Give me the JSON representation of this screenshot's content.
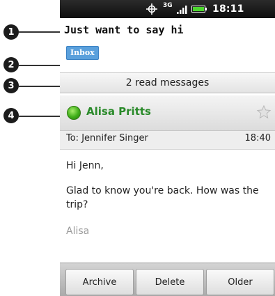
{
  "status_bar": {
    "network": "3G",
    "time": "18:11"
  },
  "email": {
    "subject": "Just want to say hi",
    "label": "Inbox",
    "read_messages": "2 read messages",
    "sender": "Alisa Pritts",
    "to": "To: Jennifer Singer",
    "time": "18:40",
    "body": {
      "greeting": "Hi Jenn,",
      "paragraph": "Glad to know you're back. How was the trip?",
      "signature": "Alisa"
    }
  },
  "actions": {
    "archive": "Archive",
    "delete": "Delete",
    "older": "Older"
  },
  "callouts": [
    "1",
    "2",
    "3",
    "4"
  ],
  "colors": {
    "label_badge": "#5aa0dc",
    "sender_name": "#2a8a2a",
    "presence_online": "#3fae19"
  },
  "icons": [
    "gps-icon",
    "signal-icon",
    "battery-icon",
    "star-icon",
    "presence-icon"
  ]
}
